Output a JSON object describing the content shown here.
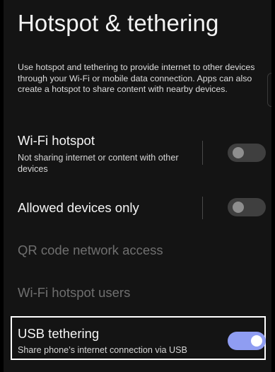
{
  "header": {
    "title": "Hotspot & tethering"
  },
  "description": "Use hotspot and tethering to provide internet to other devices through your Wi-Fi or mobile data connection. Apps can also create a hotspot to share content with nearby devices.",
  "settings": {
    "wifi_hotspot": {
      "title": "Wi-Fi hotspot",
      "subtitle": "Not sharing internet or content with other devices",
      "enabled": false
    },
    "allowed_devices": {
      "title": "Allowed devices only",
      "enabled": false
    },
    "qr_code": {
      "title": "QR code network access"
    },
    "hotspot_users": {
      "title": "Wi-Fi hotspot users"
    },
    "usb_tethering": {
      "title": "USB tethering",
      "subtitle": "Share phone’s internet connection via USB",
      "enabled": true
    }
  },
  "colors": {
    "background": "#141414",
    "switch_on": "#8f9df2",
    "switch_off": "#3f3f3f",
    "disabled_text": "#6f6f6f",
    "highlight_border": "#ffffff"
  }
}
